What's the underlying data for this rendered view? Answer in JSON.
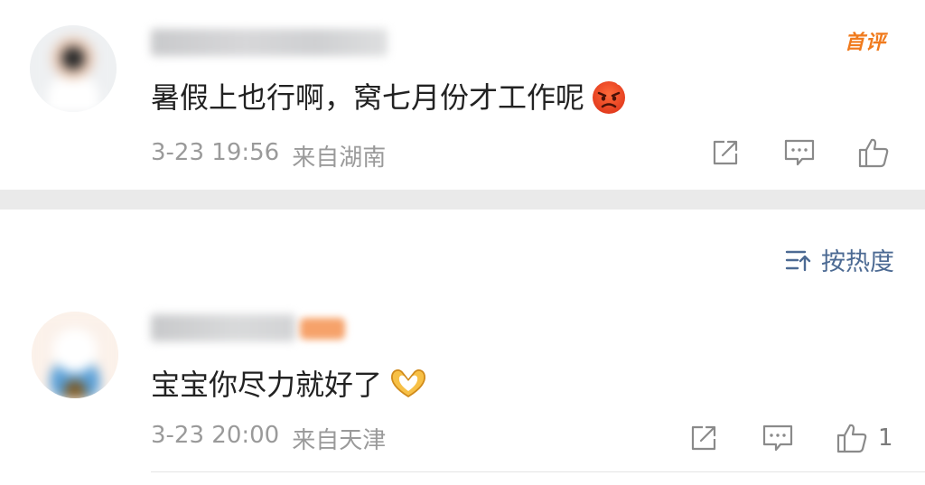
{
  "comments": [
    {
      "first_badge": "首评",
      "text": "暑假上也行啊，窝七月份才工作呢",
      "emoji": "angry-face-emoji",
      "time": "3-23 19:56",
      "location": "来自湖南",
      "likes": ""
    },
    {
      "text": "宝宝你尽力就好了",
      "emoji": "heart-hands-emoji",
      "time": "3-23 20:00",
      "location": "来自天津",
      "likes": "1"
    }
  ],
  "sort": {
    "label": "按热度",
    "icon": "sort-icon"
  },
  "icons": {
    "repost": "repost-icon",
    "comment": "comment-icon",
    "like": "thumbs-up-icon"
  },
  "colors": {
    "accent_orange": "#f07b1e",
    "link_blue": "#4c6a93",
    "meta_gray": "#9a9a9a",
    "text": "#222222",
    "divider": "#eaeaea"
  }
}
